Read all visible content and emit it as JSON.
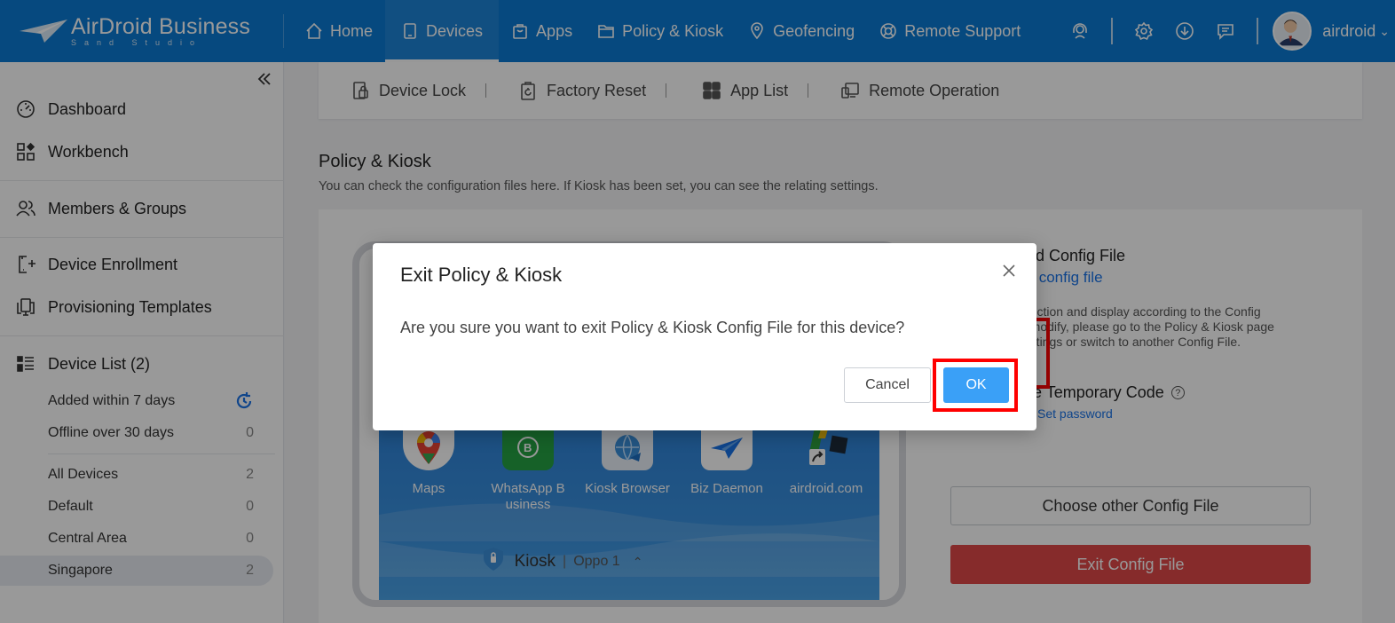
{
  "brand": {
    "title": "AirDroid Business",
    "subtitle": "Sand Studio",
    "logo_icon": "paper-plane-logo"
  },
  "nav": {
    "items": [
      {
        "label": "Home",
        "icon": "home-icon"
      },
      {
        "label": "Devices",
        "icon": "device-icon",
        "active": true
      },
      {
        "label": "Apps",
        "icon": "bag-icon"
      },
      {
        "label": "Policy & Kiosk",
        "icon": "folder-icon"
      },
      {
        "label": "Geofencing",
        "icon": "map-pin-icon"
      },
      {
        "label": "Remote Support",
        "icon": "lifebuoy-icon"
      }
    ]
  },
  "user": {
    "name": "airdroid"
  },
  "sidebar": {
    "items": [
      {
        "label": "Dashboard"
      },
      {
        "label": "Workbench"
      },
      {
        "label": "Members & Groups"
      },
      {
        "label": "Device Enrollment"
      },
      {
        "label": "Provisioning Templates"
      },
      {
        "label": "Device List (2)"
      }
    ],
    "filters": [
      {
        "label": "Added within 7 days"
      },
      {
        "label": "Offline over 30 days",
        "count": "0"
      }
    ],
    "groups": [
      {
        "label": "All Devices",
        "count": "2"
      },
      {
        "label": "Default",
        "count": "0"
      },
      {
        "label": "Central Area",
        "count": "0"
      },
      {
        "label": "Singapore",
        "count": "2",
        "active": true
      }
    ]
  },
  "actions": {
    "device_lock": "Device Lock",
    "factory_reset": "Factory Reset",
    "app_list": "App List",
    "remote_operation": "Remote Operation"
  },
  "section": {
    "title": "Policy & Kiosk",
    "desc": "You can check the configuration files here. If Kiosk has been set, you can see the relating settings."
  },
  "phone": {
    "apps": [
      {
        "label": "Maps"
      },
      {
        "label": "WhatsApp B usiness"
      },
      {
        "label": "Kiosk Browser"
      },
      {
        "label": "Biz Daemon"
      },
      {
        "label": "airdroid.com"
      }
    ],
    "kiosk_label": "Kiosk",
    "device_name": "Oppo 1"
  },
  "config": {
    "applied_title": "lied Config File",
    "applied_link": "cy config file",
    "desc_line1": "function and display according to the Config",
    "desc_line2": "o modify, please go to the Policy & Kiosk page",
    "desc_line3": "settings or switch to another Config File.",
    "temp_code_title": "ate Temporary Code",
    "temp_code_help": "?",
    "set_password": "Set password",
    "choose_other": "Choose other Config File",
    "exit": "Exit Config File"
  },
  "modal": {
    "title": "Exit Policy & Kiosk",
    "body": "Are you sure you want to exit Policy & Kiosk Config File for this device?",
    "cancel": "Cancel",
    "ok": "OK"
  },
  "colors": {
    "topbar": "#0a7ad4",
    "ok_button": "#3aa0f7",
    "exit_button": "#e04848",
    "highlight": "#ff0000",
    "link": "#1a73e8"
  }
}
